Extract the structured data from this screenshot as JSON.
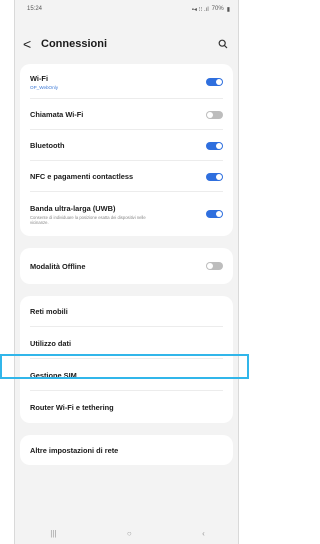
{
  "status": {
    "time": "15:24",
    "battery": "70%"
  },
  "header": {
    "title": "Connessioni"
  },
  "icons": {
    "back": "chevron-left-icon",
    "search": "search-icon"
  },
  "colors": {
    "toggle_on": "#2f6fde",
    "toggle_off": "#bdbdbd",
    "highlight": "#31b6ea",
    "link": "#3a78d6"
  },
  "card1": {
    "wifi": {
      "label": "Wi-Fi",
      "sub": "OP_WebOnly",
      "on": true
    },
    "wifi_call": {
      "label": "Chiamata Wi-Fi",
      "on": false
    },
    "bluetooth": {
      "label": "Bluetooth",
      "on": true
    },
    "nfc": {
      "label": "NFC e pagamenti contactless",
      "on": true
    },
    "uwb": {
      "label": "Banda ultra-larga (UWB)",
      "desc": "Consente di individuare la posizione esatta dei dispositivi nelle vicinanze.",
      "on": true
    }
  },
  "card2": {
    "offline": {
      "label": "Modalità Offline",
      "on": false
    }
  },
  "card3": {
    "items": [
      "Reti mobili",
      "Utilizzo dati",
      "Gestione SIM",
      "Router Wi-Fi e tethering"
    ]
  },
  "card4": {
    "label": "Altre impostazioni di rete"
  },
  "navbar": {
    "recents": "|||",
    "home": "○",
    "back": "‹"
  }
}
